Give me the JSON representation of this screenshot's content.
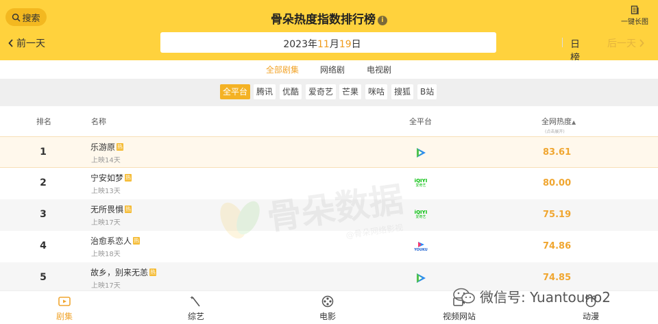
{
  "header": {
    "search_label": "搜索",
    "title": "骨朵热度指数排行榜",
    "info_glyph": "i",
    "longshot_label": "一键长图",
    "prev_day": "前一天",
    "next_day": "后一天",
    "date": {
      "year": "2023",
      "year_unit": "年",
      "month": "11",
      "month_unit": "月",
      "day": "19",
      "day_unit": "日"
    },
    "period": "日榜"
  },
  "category_tabs": [
    {
      "label": "全部剧集",
      "active": true
    },
    {
      "label": "网络剧",
      "active": false
    },
    {
      "label": "电视剧",
      "active": false
    }
  ],
  "platform_filters": [
    {
      "label": "全平台",
      "active": true
    },
    {
      "label": "腾讯",
      "active": false
    },
    {
      "label": "优酷",
      "active": false
    },
    {
      "label": "爱奇艺",
      "active": false
    },
    {
      "label": "芒果",
      "active": false
    },
    {
      "label": "咪咕",
      "active": false
    },
    {
      "label": "搜狐",
      "active": false
    },
    {
      "label": "B站",
      "active": false
    }
  ],
  "table": {
    "col_rank": "排名",
    "col_name": "名称",
    "col_platform": "全平台",
    "col_heat": "全网热度",
    "sort_glyph": "▲",
    "heat_hint": "(点击展开)",
    "hot_badge": "热",
    "rows": [
      {
        "rank": "1",
        "title": "乐游原",
        "days": "上映14天",
        "platform": "tencent-video",
        "heat": "83.61"
      },
      {
        "rank": "2",
        "title": "宁安如梦",
        "days": "上映13天",
        "platform": "iqiyi",
        "heat": "80.00"
      },
      {
        "rank": "3",
        "title": "无所畏惧",
        "days": "上映17天",
        "platform": "iqiyi",
        "heat": "75.19"
      },
      {
        "rank": "4",
        "title": "治愈系恋人",
        "days": "上映18天",
        "platform": "youku",
        "heat": "74.86"
      },
      {
        "rank": "5",
        "title": "故乡，别来无恙",
        "days": "上映17天",
        "platform": "tencent-video",
        "heat": "74.85"
      }
    ]
  },
  "platform_logo_text": {
    "iqiyi": "iQIYI",
    "iqiyi_sub": "爱奇艺",
    "youku": "YOUKU"
  },
  "watermark": {
    "main": "骨朵数据",
    "sub": "@骨朵网络影视"
  },
  "bottom_nav": [
    {
      "label": "剧集",
      "icon": "tv-icon",
      "active": true
    },
    {
      "label": "综艺",
      "icon": "magic-wand-icon",
      "active": false
    },
    {
      "label": "电影",
      "icon": "film-reel-icon",
      "active": false
    },
    {
      "label": "视频网站",
      "icon": "video-site-icon",
      "active": false
    },
    {
      "label": "动漫",
      "icon": "anime-icon",
      "active": false
    }
  ],
  "wechat_watermark": "微信号: Yuantouno2",
  "colors": {
    "brand": "#ffd23d",
    "accent": "#f0a630",
    "hot": "#f5bb33"
  }
}
